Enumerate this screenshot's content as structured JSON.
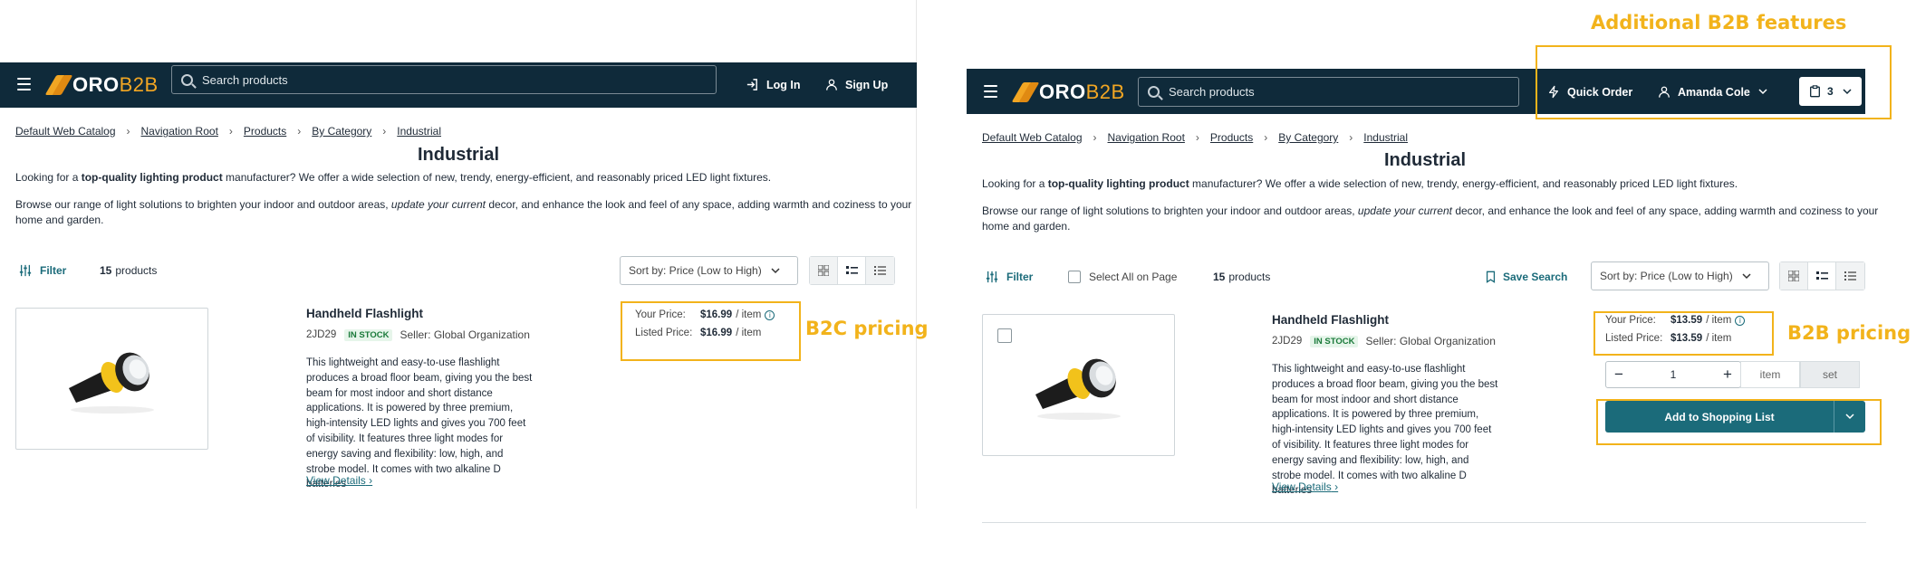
{
  "brand": {
    "logo_oro": "ORO",
    "logo_b2b": "B2B",
    "accent": "#f2a623",
    "header_bg": "#0f2a3a",
    "primary": "#1b6b7a",
    "annotation": "#f2b31b"
  },
  "left": {
    "search_placeholder": "Search products",
    "login_label": "Log In",
    "signup_label": "Sign Up",
    "breadcrumbs": [
      "Default Web Catalog",
      "Navigation Root",
      "Products",
      "By Category",
      "Industrial"
    ],
    "title": "Industrial",
    "desc1": {
      "pre": "Looking for a ",
      "bold": "top-quality lighting product",
      "post": " manufacturer? We offer a wide selection of new, trendy, energy-efficient, and reasonably priced LED light fixtures."
    },
    "desc2": {
      "pre": "Browse our range of light solutions to brighten your indoor and outdoor areas, ",
      "italic": "update your current",
      "post": " decor, and enhance the look and feel of any space, adding warmth and coziness to your home and garden."
    },
    "filter_label": "Filter",
    "count_number": "15",
    "count_label": "products",
    "sort_label": "Sort by:  Price (Low to High)",
    "product": {
      "name": "Handheld Flashlight",
      "sku": "2JD29",
      "stock": "IN STOCK",
      "seller": "Seller: Global Organization",
      "description": "This lightweight and easy-to-use flashlight produces a broad floor beam, giving you the best beam for most indoor and short distance applications. It is powered by three premium, high-intensity LED lights and gives you 700 feet of visibility. It features three light modes for energy saving and flexibility: low, high, and strobe model. It comes with two alkaline D batteries",
      "view_details": "View Details"
    },
    "price": {
      "your_label": "Your Price:",
      "your_value": "$16.99",
      "your_unit": "/ item",
      "listed_label": "Listed Price:",
      "listed_value": "$16.99",
      "listed_unit": "/ item"
    },
    "annotation": "B2C  pricing"
  },
  "right": {
    "search_placeholder": "Search products",
    "quick_order_label": "Quick Order",
    "user_name": "Amanda Cole",
    "cart_count": "3",
    "breadcrumbs": [
      "Default Web Catalog",
      "Navigation Root",
      "Products",
      "By Category",
      "Industrial"
    ],
    "title": "Industrial",
    "desc1": {
      "pre": "Looking for a ",
      "bold": "top-quality lighting product",
      "post": " manufacturer? We offer a wide selection of new, trendy, energy-efficient, and reasonably priced LED light fixtures."
    },
    "desc2": {
      "pre": "Browse our range of light solutions to brighten your indoor and outdoor areas, ",
      "italic": "update your current",
      "post": " decor, and enhance the look and feel of any space, adding warmth and coziness to your home and garden."
    },
    "filter_label": "Filter",
    "select_all_label": "Select All on Page",
    "count_number": "15",
    "count_label": "products",
    "save_search_label": "Save Search",
    "sort_label": "Sort by:  Price (Low to High)",
    "product": {
      "name": "Handheld Flashlight",
      "sku": "2JD29",
      "stock": "IN STOCK",
      "seller": "Seller: Global Organization",
      "description": "This lightweight and easy-to-use flashlight produces a broad floor beam, giving you the best beam for most indoor and short distance applications. It is powered by three premium, high-intensity LED lights and gives you 700 feet of visibility. It features three light modes for energy saving and flexibility: low, high, and strobe model. It comes with two alkaline D batteries",
      "view_details": "View Details"
    },
    "price": {
      "your_label": "Your Price:",
      "your_value": "$13.59",
      "your_unit": "/ item",
      "listed_label": "Listed Price:",
      "listed_value": "$13.59",
      "listed_unit": "/ item"
    },
    "quantity": "1",
    "unit_item": "item",
    "unit_set": "set",
    "add_button": {
      "pre": "Add to ",
      "bold": "Shopping List"
    },
    "annotation_pricing": "B2B pricing",
    "annotation_features": "Additional B2B features"
  }
}
